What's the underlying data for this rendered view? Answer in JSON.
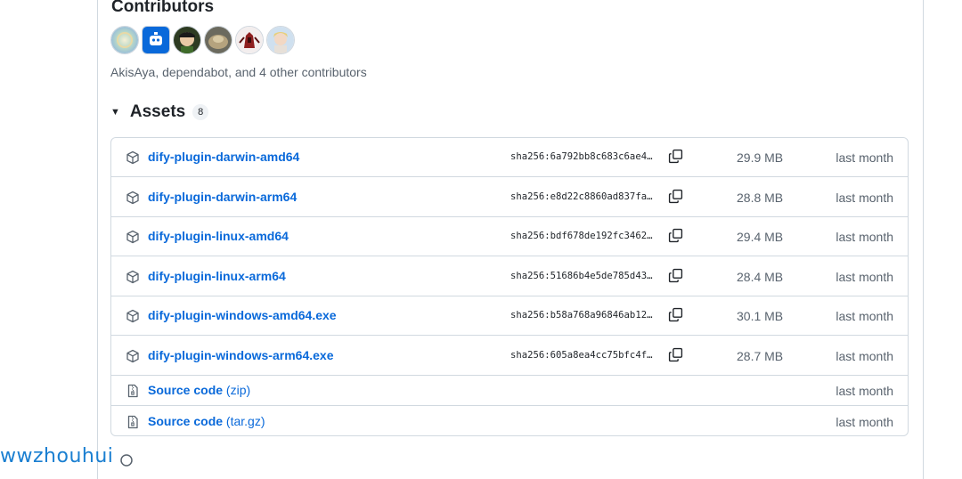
{
  "contributors": {
    "title": "Contributors",
    "avatars": [
      "avatar-1",
      "avatar-dependabot",
      "avatar-3",
      "avatar-4",
      "avatar-5",
      "avatar-6"
    ],
    "summary": "AkisAya, dependabot, and 4 other contributors"
  },
  "assets": {
    "title": "Assets",
    "count": "8",
    "items": [
      {
        "name": "dify-plugin-darwin-amd64",
        "sha": "sha256:6a792bb8c683c6ae4…",
        "size": "29.9 MB",
        "date": "last month"
      },
      {
        "name": "dify-plugin-darwin-arm64",
        "sha": "sha256:e8d22c8860ad837fa…",
        "size": "28.8 MB",
        "date": "last month"
      },
      {
        "name": "dify-plugin-linux-amd64",
        "sha": "sha256:bdf678de192fc3462…",
        "size": "29.4 MB",
        "date": "last month"
      },
      {
        "name": "dify-plugin-linux-arm64",
        "sha": "sha256:51686b4e5de785d43…",
        "size": "28.4 MB",
        "date": "last month"
      },
      {
        "name": "dify-plugin-windows-amd64.exe",
        "sha": "sha256:b58a768a96846ab12…",
        "size": "30.1 MB",
        "date": "last month"
      },
      {
        "name": "dify-plugin-windows-arm64.exe",
        "sha": "sha256:605a8ea4cc75bfc4f…",
        "size": "28.7 MB",
        "date": "last month"
      }
    ],
    "source": [
      {
        "name": "Source code",
        "suffix": "(zip)",
        "date": "last month"
      },
      {
        "name": "Source code",
        "suffix": "(tar.gz)",
        "date": "last month"
      }
    ]
  },
  "footer": {
    "username": "wwzhouhui"
  },
  "colors": {
    "link": "#0969da",
    "muted": "#59636e",
    "border": "#d1d9e0"
  },
  "icons": {
    "asset": "package-icon",
    "source": "file-zip-icon",
    "copy": "copy-icon",
    "caret": "triangle-down-icon"
  }
}
